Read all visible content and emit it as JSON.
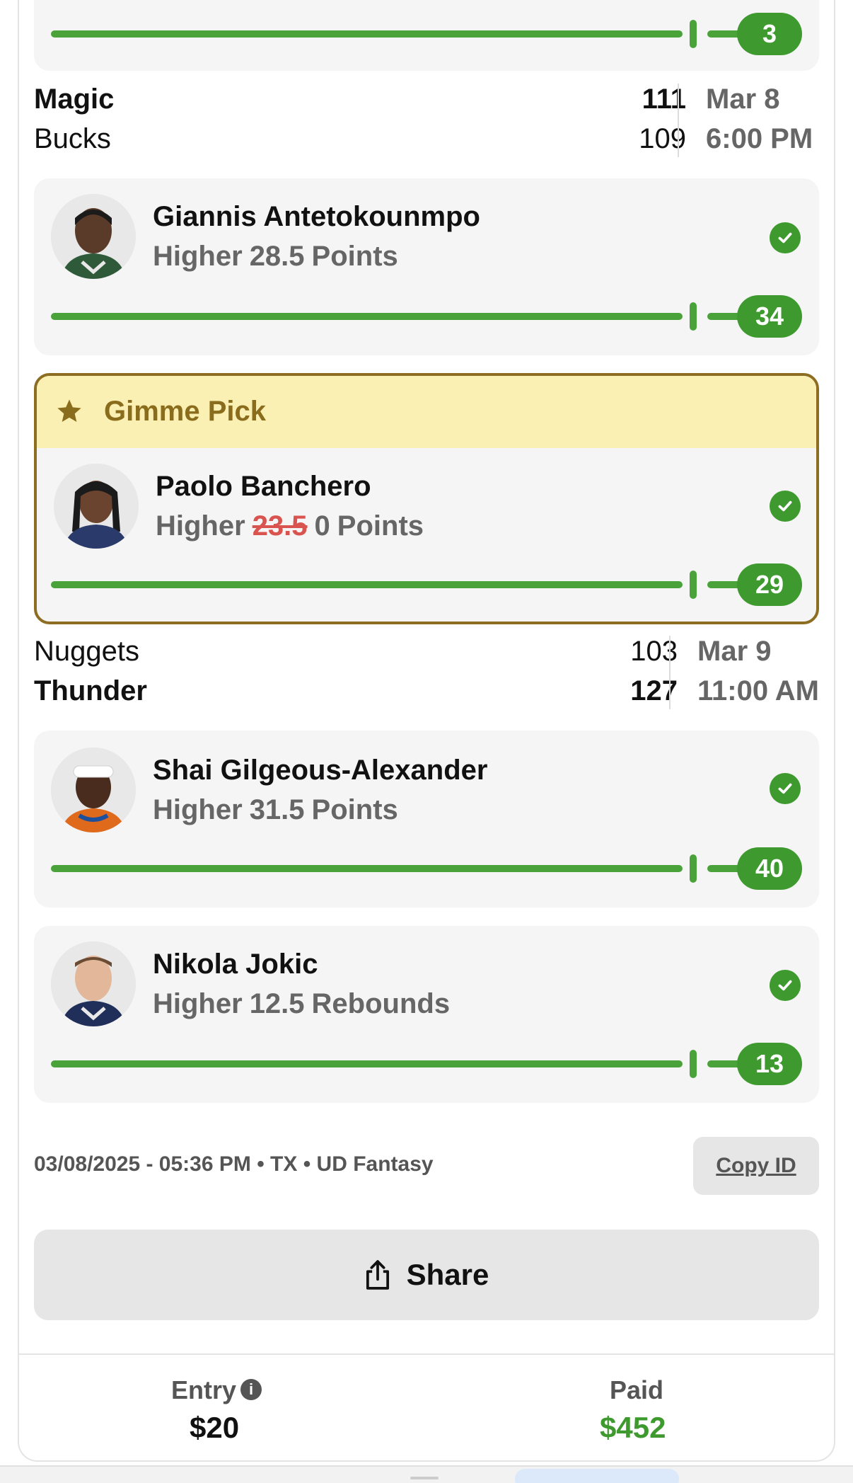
{
  "top_partial": {
    "actual": "3"
  },
  "games": [
    {
      "team1": "Magic",
      "score1": "111",
      "team2": "Bucks",
      "score2": "109",
      "date": "Mar 8",
      "time": "6:00 PM",
      "picks": [
        {
          "player": "Giannis Antetokounmpo",
          "direction": "Higher",
          "line": "28.5",
          "stat": "Points",
          "actual": "34"
        }
      ]
    },
    {
      "team1": "Nuggets",
      "score1": "103",
      "team2": "Thunder",
      "score2": "127",
      "date": "Mar 9",
      "time": "11:00 AM",
      "picks": [
        {
          "player": "Shai Gilgeous-Alexander",
          "direction": "Higher",
          "line": "31.5",
          "stat": "Points",
          "actual": "40"
        },
        {
          "player": "Nikola Jokic",
          "direction": "Higher",
          "line": "12.5",
          "stat": "Rebounds",
          "actual": "13"
        }
      ]
    }
  ],
  "gimme": {
    "label": "Gimme Pick",
    "player": "Paolo Banchero",
    "direction": "Higher",
    "original_line": "23.5",
    "line": "0",
    "stat": "Points",
    "actual": "29"
  },
  "meta": "03/08/2025 - 05:36 PM • TX • UD Fantasy",
  "copy_id_label": "Copy ID",
  "share_label": "Share",
  "footer": {
    "entry_label": "Entry",
    "entry_value": "$20",
    "paid_label": "Paid",
    "paid_value": "$452"
  },
  "colors": {
    "success": "#3e9a2e",
    "gimme_border": "#8c6d22",
    "gimme_bg": "#fbf0b3",
    "paid": "#3e9a2e"
  },
  "icons": {
    "check": "check-circle-icon",
    "star": "star-icon",
    "share": "share-icon",
    "info": "info-icon"
  }
}
